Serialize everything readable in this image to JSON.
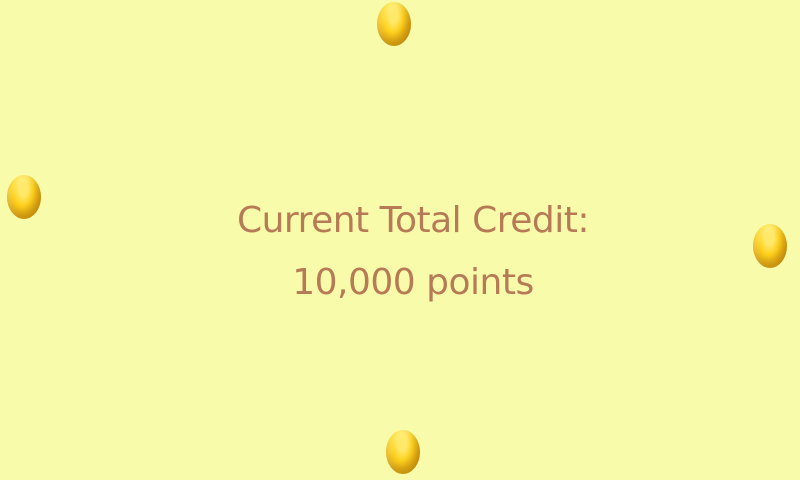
{
  "credit_screen": {
    "title": "Current Total Credit:",
    "points_text": "10,000 points"
  },
  "decorations": {
    "coin_icon": "gold-coin-icon"
  }
}
